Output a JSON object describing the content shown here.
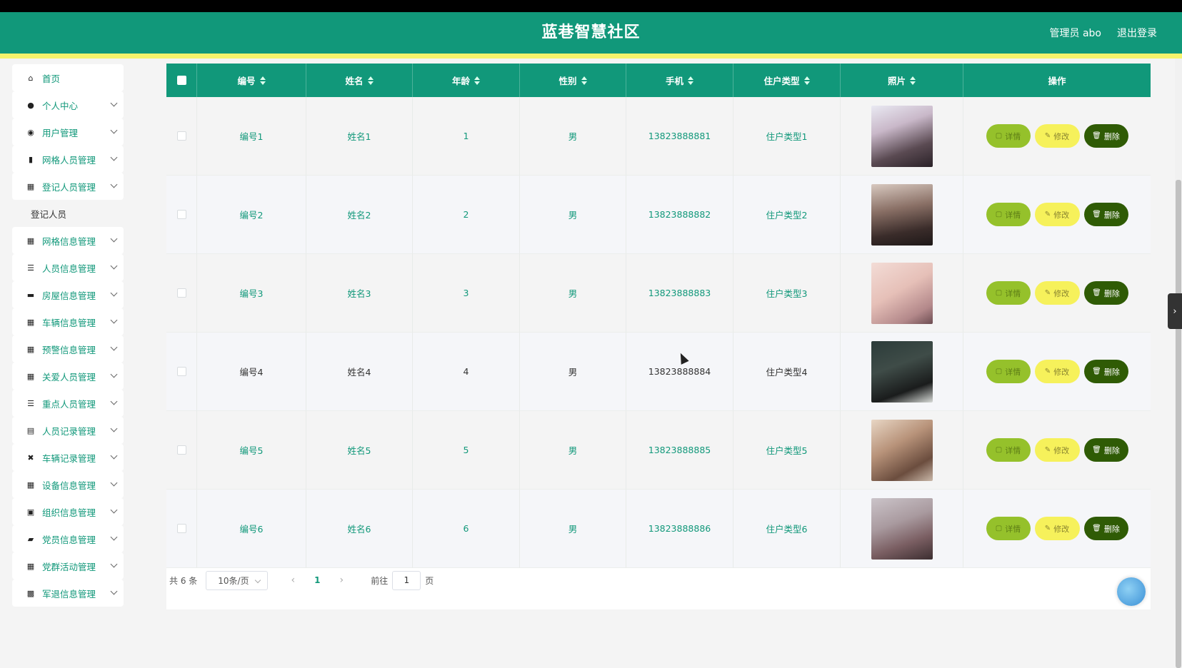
{
  "header": {
    "app_title": "蓝巷智慧社区",
    "admin_label": "管理员 abo",
    "logout_label": "退出登录",
    "colors": {
      "primary": "#11987a",
      "accent_stripe": "#f5f36c"
    }
  },
  "sidebar": {
    "items": [
      {
        "label": "首页",
        "icon": "home-icon",
        "has_children": false
      },
      {
        "label": "个人中心",
        "icon": "user-icon",
        "has_children": true
      },
      {
        "label": "用户管理",
        "icon": "bulb-icon",
        "has_children": true
      },
      {
        "label": "网格人员管理",
        "icon": "bar-chart-icon",
        "has_children": true
      },
      {
        "label": "登记人员管理",
        "icon": "grid-icon",
        "has_children": true,
        "expanded": true
      },
      {
        "label": "网格信息管理",
        "icon": "apps-icon",
        "has_children": true
      },
      {
        "label": "人员信息管理",
        "icon": "sliders-icon",
        "has_children": true
      },
      {
        "label": "房屋信息管理",
        "icon": "monitor-icon",
        "has_children": true
      },
      {
        "label": "车辆信息管理",
        "icon": "grid-icon",
        "has_children": true
      },
      {
        "label": "预警信息管理",
        "icon": "grid-icon",
        "has_children": true
      },
      {
        "label": "关爱人员管理",
        "icon": "grid-icon",
        "has_children": true
      },
      {
        "label": "重点人员管理",
        "icon": "list-icon",
        "has_children": true
      },
      {
        "label": "人员记录管理",
        "icon": "clipboard-icon",
        "has_children": true
      },
      {
        "label": "车辆记录管理",
        "icon": "ticket-icon",
        "has_children": true
      },
      {
        "label": "设备信息管理",
        "icon": "grid-icon",
        "has_children": true
      },
      {
        "label": "组织信息管理",
        "icon": "clipboard-check-icon",
        "has_children": true
      },
      {
        "label": "党员信息管理",
        "icon": "wallet-icon",
        "has_children": true
      },
      {
        "label": "党群活动管理",
        "icon": "grid-icon",
        "has_children": true
      },
      {
        "label": "军退信息管理",
        "icon": "briefcase-icon",
        "has_children": true
      }
    ],
    "submenu_label": "登记人员"
  },
  "table": {
    "columns": [
      "编号",
      "姓名",
      "年龄",
      "性别",
      "手机",
      "住户类型",
      "照片",
      "操作"
    ],
    "rows": [
      {
        "no": "编号1",
        "name": "姓名1",
        "age": "1",
        "sex": "男",
        "phone": "13823888881",
        "type": "住户类型1"
      },
      {
        "no": "编号2",
        "name": "姓名2",
        "age": "2",
        "sex": "男",
        "phone": "13823888882",
        "type": "住户类型2"
      },
      {
        "no": "编号3",
        "name": "姓名3",
        "age": "3",
        "sex": "男",
        "phone": "13823888883",
        "type": "住户类型3"
      },
      {
        "no": "编号4",
        "name": "姓名4",
        "age": "4",
        "sex": "男",
        "phone": "13823888884",
        "type": "住户类型4"
      },
      {
        "no": "编号5",
        "name": "姓名5",
        "age": "5",
        "sex": "男",
        "phone": "13823888885",
        "type": "住户类型5"
      },
      {
        "no": "编号6",
        "name": "姓名6",
        "age": "6",
        "sex": "男",
        "phone": "13823888886",
        "type": "住户类型6"
      }
    ],
    "actions": {
      "detail": "详情",
      "edit": "修改",
      "delete": "删除"
    }
  },
  "pagination": {
    "total": "共 6 条",
    "page_size": "10条/页",
    "current_page": "1",
    "goto_prefix": "前往",
    "goto_value": "1",
    "goto_suffix": "页"
  }
}
